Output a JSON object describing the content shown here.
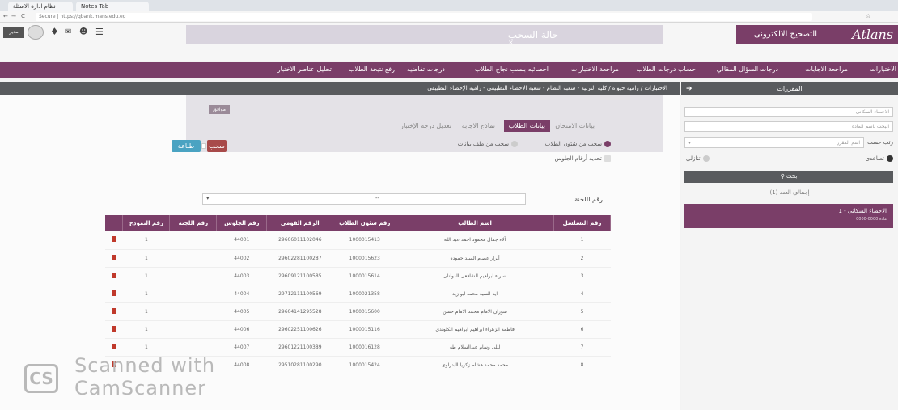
{
  "browser": {
    "tabs": [
      "نظام ادارة الاسئلة",
      "Notes Tab"
    ],
    "url_prefix": "Secure",
    "url": "https://qbank.mans.edu.eg"
  },
  "header": {
    "dialog_title": "حالة السحب",
    "dialog_close": "×",
    "brand_subtitle": "التصحيح الالكترونى",
    "brand_logo": "Atlans",
    "user_badge": "مدير"
  },
  "nav": {
    "items": [
      "الاختبارات",
      "مراجعة الاجابات",
      "درجات السؤال المقالي",
      "حساب درجات الطلاب",
      "مراجعة الاختبارات",
      "احصائيه بنسب نجاح الطلاب",
      "درجات تفاضيه",
      "رفع نتيجة الطلاب",
      "تحليل عناصر الاختبار"
    ]
  },
  "breadcrumb": "الاختبارات / رامية حيواة / كلية التربية - شعبة النظام - شعبة الاحصاء التطبيقي - رامية الإحصاء التطبيقي",
  "tabs": {
    "exam_data": "بيانات الامتحان",
    "students_data": "بيانات الطلاب",
    "answer_models": "نماذج الاجابة",
    "edit_grade": "تعديل درجة الإختبار",
    "mini_btn": "موافق"
  },
  "options": {
    "from_affairs": "سحب من شئون الطلاب",
    "from_file": "سحب من ملف بيانات",
    "seat_numbers": "تحديد أرقام الجلوس"
  },
  "actions": {
    "print": "طباعة",
    "pull": "سحب"
  },
  "committee": {
    "label": "رقم اللجنة",
    "value": "--"
  },
  "table": {
    "headers": [
      "رقم التسلسل",
      "اسم الطالب",
      "رقم شئون الطلاب",
      "الرقم القومى",
      "رقم الجلوس",
      "رقم اللجنة",
      "رقم النموذج"
    ],
    "rows": [
      {
        "seq": "1",
        "name": "آلاء جمال محمود احمد عبد الله",
        "affairs": "1000015413",
        "national": "29606011102046",
        "seat": "44001",
        "committee": "",
        "model": "1"
      },
      {
        "seq": "2",
        "name": "أبرار عصام السيد حموده",
        "affairs": "1000015623",
        "national": "29602281100287",
        "seat": "44002",
        "committee": "",
        "model": "1"
      },
      {
        "seq": "3",
        "name": "اسراء ابراهيم الشافعى الدوانلى",
        "affairs": "1000015614",
        "national": "29609121100585",
        "seat": "44003",
        "committee": "",
        "model": "1"
      },
      {
        "seq": "4",
        "name": "ايه السيد محمد ابو زيد",
        "affairs": "1000021358",
        "national": "29712111100569",
        "seat": "44004",
        "committee": "",
        "model": "1"
      },
      {
        "seq": "5",
        "name": "سوزان الامام محمد الامام حسن",
        "affairs": "1000015600",
        "national": "29604141295528",
        "seat": "44005",
        "committee": "",
        "model": "1"
      },
      {
        "seq": "6",
        "name": "فاطمه الزهراء ابراهيم ابراهيم الكلونذى",
        "affairs": "1000015116",
        "national": "29602251100626",
        "seat": "44006",
        "committee": "",
        "model": "1"
      },
      {
        "seq": "7",
        "name": "ليلى وسام عبدالسلام طه",
        "affairs": "1000016128",
        "national": "29601221100389",
        "seat": "44007",
        "committee": "",
        "model": "1"
      },
      {
        "seq": "8",
        "name": "محمد محمد هشام زكريا البدراوى",
        "affairs": "1000015424",
        "national": "29510281100290",
        "seat": "44008",
        "committee": "",
        "model": "1"
      }
    ]
  },
  "right_panel": {
    "title": "المقررات",
    "course_input": "الاحصاء السكانى",
    "name_placeholder": "البحث باسم المادة",
    "sort_label": "رتب حسب",
    "sort_value": "اسم المقرر",
    "asc": "تصاعدى",
    "desc": "تنازلى",
    "search_button": "بحث",
    "total": "إجمالى العدد (1)",
    "card_title": "1 - الاحصاء السكانى",
    "card_sub": "0000-0000 مادة"
  },
  "watermark": {
    "badge": "CS",
    "line1": "Scanned with",
    "line2": "CamScanner"
  },
  "colors": {
    "brand": "#7a3e68",
    "dark_bar": "#595b5e",
    "print_btn": "#4aa3c2",
    "pull_btn": "#a84a4a"
  }
}
